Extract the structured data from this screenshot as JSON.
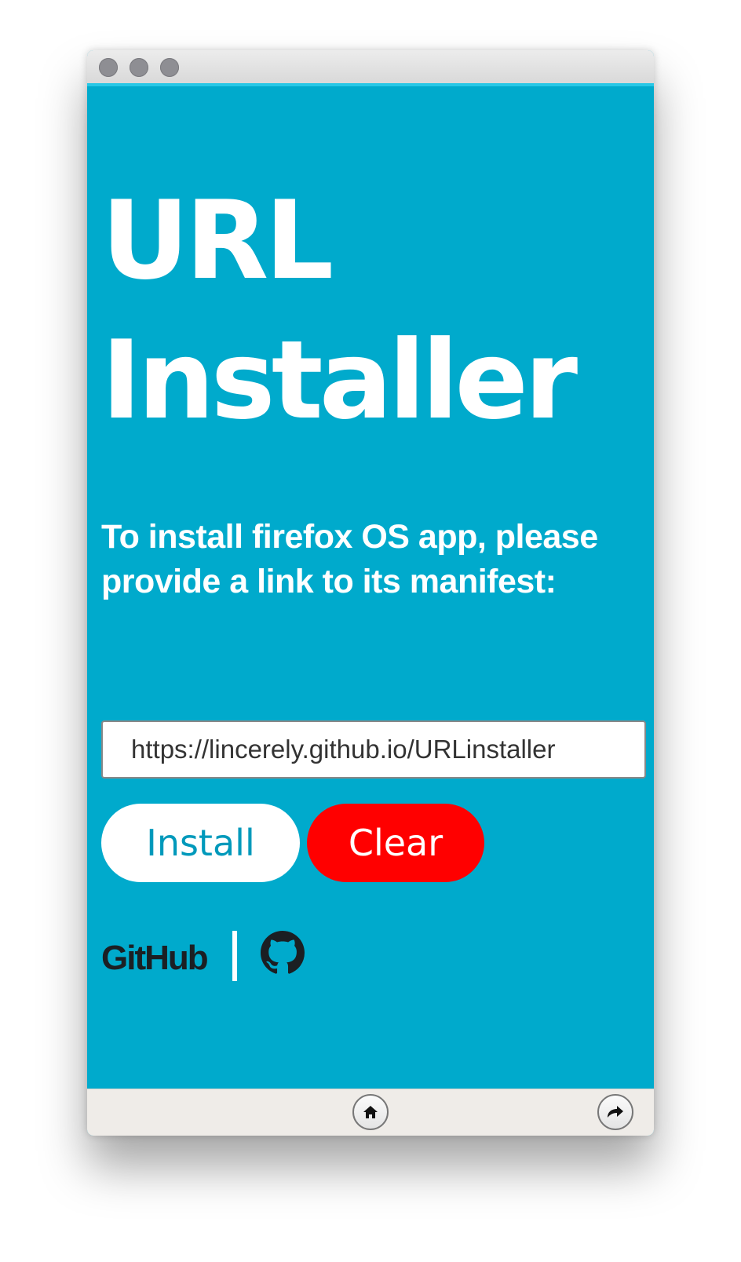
{
  "window": {
    "controls": [
      "close",
      "minimize",
      "zoom"
    ]
  },
  "main": {
    "title_line1": "URL",
    "title_line2": "Installer",
    "prompt": "To install firefox OS app, please provide a link to its manifest:",
    "url_value": "https://lincerely.github.io/URLinstaller",
    "install_label": "Install",
    "clear_label": "Clear"
  },
  "footer": {
    "github_wordmark": "GitHub",
    "github_icon": "github-octocat-icon"
  },
  "bottombar": {
    "home_icon": "home-icon",
    "rotate_icon": "rotate-icon"
  },
  "colors": {
    "background": "#00aacc",
    "install_button": "#ffffff",
    "install_text": "#0099bb",
    "clear_button": "#ff0000",
    "clear_text": "#ffffff",
    "text": "#ffffff"
  }
}
